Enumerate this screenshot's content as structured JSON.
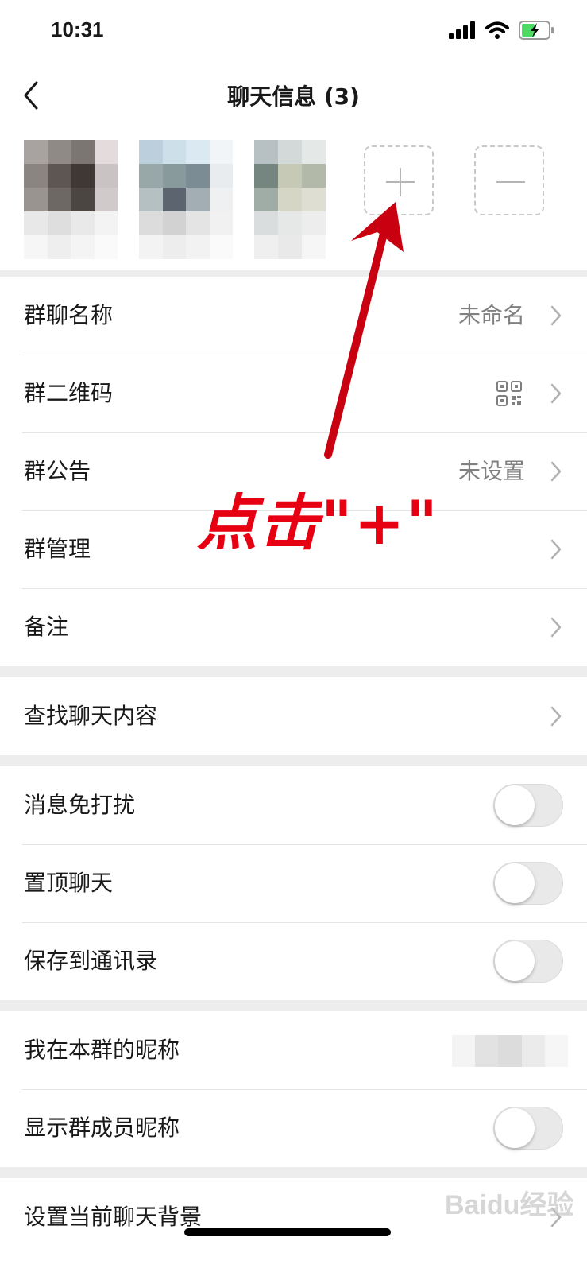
{
  "status_bar": {
    "time": "10:31"
  },
  "nav": {
    "title": "聊天信息 (3)"
  },
  "members": {
    "add_label": "+",
    "remove_label": "−"
  },
  "section1": {
    "group_name": {
      "label": "群聊名称",
      "value": "未命名"
    },
    "group_qr": {
      "label": "群二维码"
    },
    "announcement": {
      "label": "群公告",
      "value": "未设置"
    },
    "manage": {
      "label": "群管理"
    },
    "remark": {
      "label": "备注"
    }
  },
  "section2": {
    "search": {
      "label": "查找聊天内容"
    }
  },
  "section3": {
    "mute": {
      "label": "消息免打扰",
      "on": false
    },
    "pin": {
      "label": "置顶聊天",
      "on": false
    },
    "save_contacts": {
      "label": "保存到通讯录",
      "on": false
    }
  },
  "section4": {
    "my_nickname": {
      "label": "我在本群的昵称"
    },
    "show_nicknames": {
      "label": "显示群成员昵称",
      "on": false
    }
  },
  "section5": {
    "background": {
      "label": "设置当前聊天背景"
    }
  },
  "annotation": {
    "text": "点击\"+\"",
    "color": "#e60012"
  },
  "watermark": {
    "text": "Baidu经验"
  }
}
